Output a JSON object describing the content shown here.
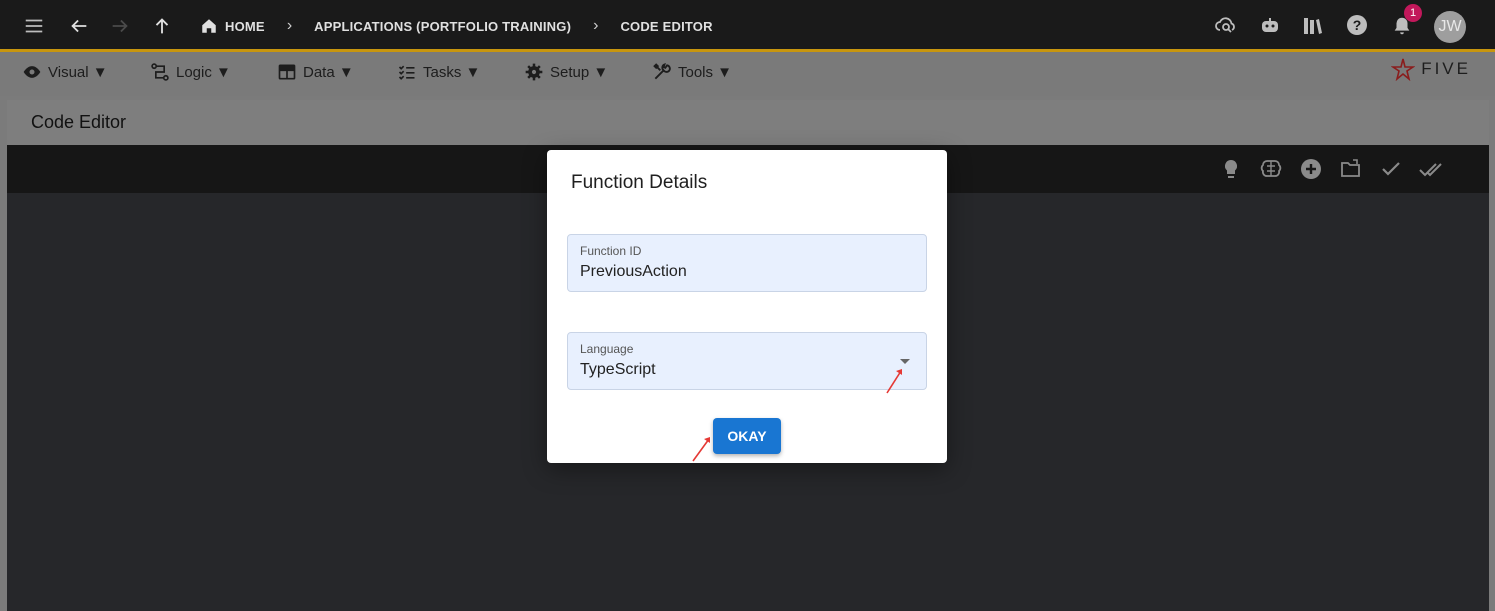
{
  "topbar": {
    "breadcrumbs": [
      "HOME",
      "APPLICATIONS (PORTFOLIO TRAINING)",
      "CODE EDITOR"
    ],
    "notification_count": "1",
    "avatar_initials": "JW",
    "icons": [
      "menu-icon",
      "back-icon",
      "forward-icon",
      "up-icon",
      "home-icon",
      "cloud-search-icon",
      "chat-bot-icon",
      "library-icon",
      "help-icon",
      "bell-icon"
    ]
  },
  "menubar": {
    "items": [
      {
        "label": "Visual ▼",
        "icon": "eye-icon"
      },
      {
        "label": "Logic ▼",
        "icon": "logic-icon"
      },
      {
        "label": "Data ▼",
        "icon": "table-icon"
      },
      {
        "label": "Tasks ▼",
        "icon": "tasks-icon"
      },
      {
        "label": "Setup ▼",
        "icon": "gear-icon"
      },
      {
        "label": "Tools ▼",
        "icon": "tools-icon"
      }
    ],
    "logo_text": "FIVE"
  },
  "page": {
    "title": "Code Editor",
    "toolbar_icons": [
      "help-bulb-icon",
      "brain-icon",
      "add-circle-icon",
      "open-folder-icon",
      "check-icon",
      "double-check-icon"
    ]
  },
  "modal": {
    "title": "Function Details",
    "function_id": {
      "label": "Function ID",
      "value": "PreviousAction"
    },
    "language": {
      "label": "Language",
      "value": "TypeScript"
    },
    "okay_label": "OKAY"
  },
  "colors": {
    "accent": "#c8960f",
    "primary_button": "#1976d2",
    "badge": "#c2185b",
    "annotation_arrow": "#e53935"
  }
}
